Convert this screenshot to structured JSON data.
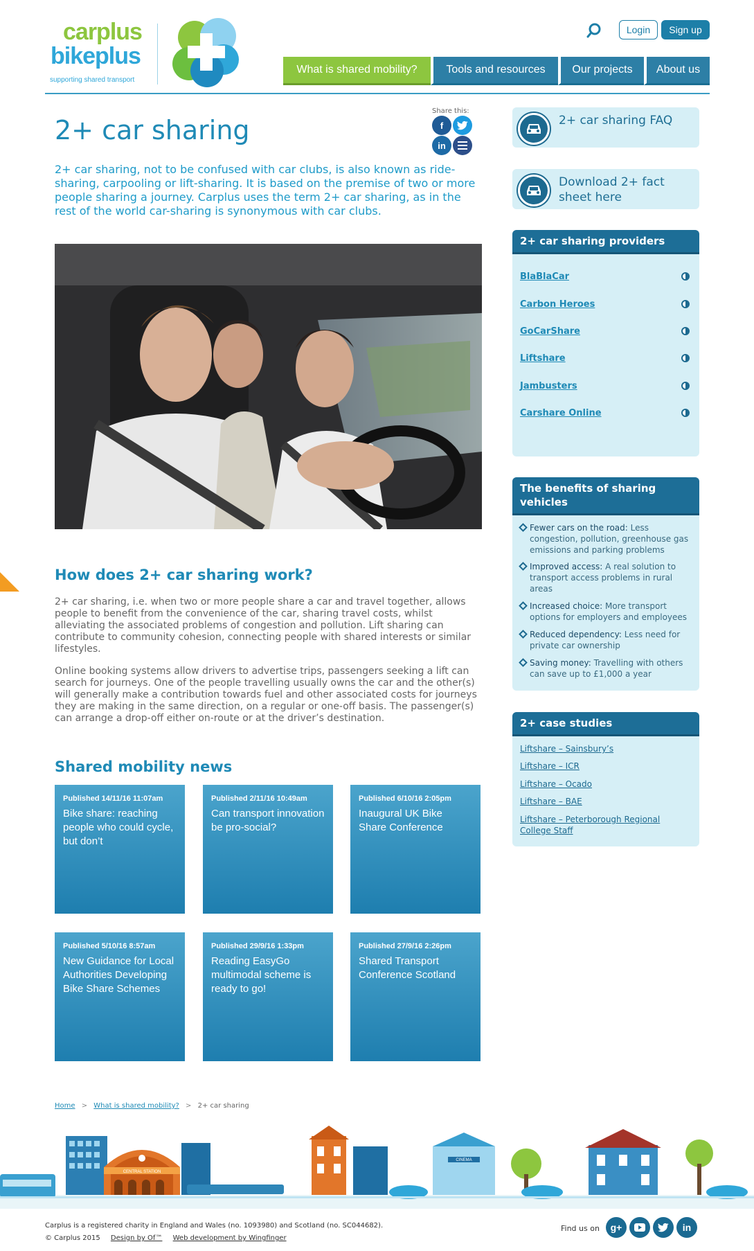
{
  "header": {
    "logo_line1": "carplus",
    "logo_line2": "bikeplus",
    "logo_tagline": "supporting shared transport",
    "login_label": "Login",
    "signup_label": "Sign up",
    "nav": [
      {
        "label": "What is shared mobility?",
        "color": "#8dc63f"
      },
      {
        "label": "Tools and resources",
        "color": "#2d7fa6"
      },
      {
        "label": "Our projects",
        "color": "#2d7fa6"
      },
      {
        "label": "About us",
        "color": "#2d7fa6"
      }
    ]
  },
  "main": {
    "title": "2+ car sharing",
    "share_label": "Share this:",
    "intro": "2+ car sharing, not to be confused with car clubs, is also known as ride-sharing, carpooling or lift-sharing. It is based on the premise of two or more people sharing a journey. Carplus uses the term 2+ car sharing, as in the rest of the world car-sharing is synonymous with car clubs.",
    "how_heading": "How does 2+ car sharing work?",
    "how_p1": "2+ car sharing, i.e. when two or more people share a car and travel together, allows people to benefit from the convenience of the car, sharing travel costs, whilst alleviating the associated problems of congestion and pollution. Lift sharing can contribute to community cohesion, connecting people with shared interests or similar lifestyles.",
    "how_p2": "Online booking systems allow drivers to advertise trips, passengers seeking a lift can search for journeys. One of the people travelling usually owns the car and the other(s) will generally make a contribution towards fuel and other associated costs for journeys they are making in the same direction, on a regular or one-off basis. The passenger(s) can arrange a drop-off either on-route or at the driver’s destination.",
    "news_heading": "Shared mobility news",
    "news": [
      {
        "published": "Published 14/11/16  11:07am",
        "title": "Bike share: reaching people who could cycle, but don’t"
      },
      {
        "published": "Published 2/11/16  10:49am",
        "title": "Can transport innovation be pro-social?"
      },
      {
        "published": "Published 6/10/16  2:05pm",
        "title": "Inaugural UK Bike Share Conference"
      },
      {
        "published": "Published 5/10/16  8:57am",
        "title": "New Guidance for Local Authorities Developing Bike Share Schemes"
      },
      {
        "published": "Published 29/9/16  1:33pm",
        "title": "Reading EasyGo multimodal scheme is ready to go!"
      },
      {
        "published": "Published 27/9/16  2:26pm",
        "title": "Shared Transport Conference Scotland"
      }
    ]
  },
  "sidebar": {
    "faq_label": "2+ car sharing FAQ",
    "download_label": "Download 2+ fact sheet here",
    "providers_heading": "2+ car sharing providers",
    "providers": [
      "BlaBlaCar",
      "Carbon Heroes",
      "GoCarShare",
      "Liftshare",
      "Jambusters",
      "Carshare Online"
    ],
    "benefits_heading": "The benefits of sharing vehicles",
    "benefits": [
      {
        "term": "Fewer cars on the road:",
        "text": "Less congestion, pollution, greenhouse gas emissions and parking problems"
      },
      {
        "term": "Improved access:",
        "text": "A real solution to transport access problems in rural areas"
      },
      {
        "term": "Increased choice:",
        "text": "More transport options for employers and employees"
      },
      {
        "term": "Reduced dependency:",
        "text": "Less need for private car ownership"
      },
      {
        "term": "Saving money:",
        "text": "Travelling with others can save up to £1,000 a year"
      }
    ],
    "cases_heading": "2+ case studies",
    "cases": [
      "Liftshare – Sainsbury’s",
      "Liftshare – ICR",
      "Liftshare – Ocado",
      "Liftshare – BAE",
      "Liftshare – Peterborough Regional College Staff"
    ]
  },
  "breadcrumb": {
    "home": "Home",
    "sep": ">",
    "section": "What is shared mobility?",
    "current": "2+ car sharing"
  },
  "footer": {
    "charity": "Carplus is a registered charity in England and Wales (no. 1093980) and Scotland (no. SC044682).",
    "copyright": "© Carplus 2015",
    "design": "Design by Of™",
    "webdev": "Web development by Wingfinger",
    "find_us": "Find us on",
    "station_sign": "CENTRAL STATION",
    "cinema_sign": "CINEMA"
  }
}
